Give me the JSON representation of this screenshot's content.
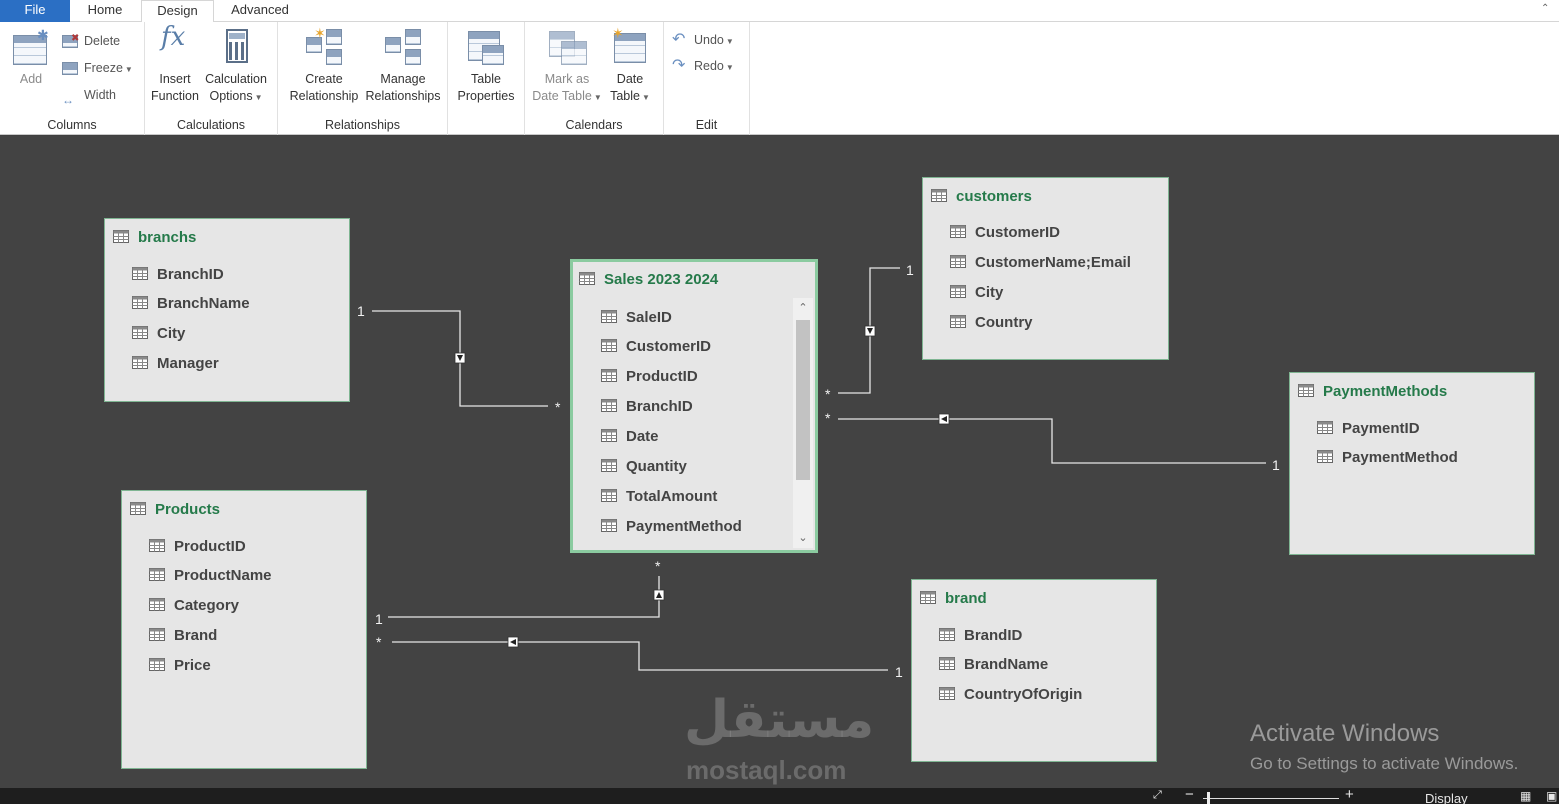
{
  "tabs": {
    "file": "File",
    "home": "Home",
    "design": "Design",
    "advanced": "Advanced"
  },
  "ribbon": {
    "columns": {
      "add": "Add",
      "delete": "Delete",
      "freeze": "Freeze",
      "width": "Width",
      "label": "Columns"
    },
    "calculations": {
      "insert_function_1": "Insert",
      "insert_function_2": "Function",
      "calc_options_1": "Calculation",
      "calc_options_2": "Options",
      "label": "Calculations"
    },
    "relationships": {
      "create_1": "Create",
      "create_2": "Relationship",
      "manage_1": "Manage",
      "manage_2": "Relationships",
      "label": "Relationships"
    },
    "table_properties": {
      "line1": "Table",
      "line2": "Properties"
    },
    "calendars": {
      "mark_1": "Mark as",
      "mark_2": "Date Table",
      "date_1": "Date",
      "date_2": "Table",
      "label": "Calendars"
    },
    "edit": {
      "undo": "Undo",
      "redo": "Redo",
      "label": "Edit"
    },
    "fx_glyph": "fx"
  },
  "tables": {
    "branchs": {
      "title": "branchs",
      "fields": [
        "BranchID",
        "BranchName",
        "City",
        "Manager"
      ]
    },
    "sales": {
      "title": "Sales 2023 2024",
      "fields": [
        "SaleID",
        "CustomerID",
        "ProductID",
        "BranchID",
        "Date",
        "Quantity",
        "TotalAmount",
        "PaymentMethod"
      ]
    },
    "customers": {
      "title": "customers",
      "fields": [
        "CustomerID",
        "CustomerName;Email",
        "City",
        "Country"
      ]
    },
    "payment": {
      "title": "PaymentMethods",
      "fields": [
        "PaymentID",
        "PaymentMethod"
      ]
    },
    "products": {
      "title": "Products",
      "fields": [
        "ProductID",
        "ProductName",
        "Category",
        "Brand",
        "Price"
      ]
    },
    "brand": {
      "title": "brand",
      "fields": [
        "BrandID",
        "BrandName",
        "CountryOfOrigin"
      ]
    }
  },
  "cardinality": {
    "branch_one": "1",
    "branch_many": "*",
    "cust_one": "1",
    "cust_many": "*",
    "pay_many": "*",
    "pay_one": "1",
    "prod_one": "1",
    "prod_many_sales": "*",
    "brand_many": "*",
    "brand_one": "1"
  },
  "watermark": {
    "arabic": "مستقل",
    "latin": "mostaql.com"
  },
  "activation": {
    "title": "Activate Windows",
    "subtitle": "Go to Settings to activate Windows."
  },
  "statusbar": {
    "display": "Display"
  },
  "colors": {
    "table_title": "#257a4a",
    "active_border": "#8bcba0",
    "canvas": "#434343",
    "file_tab": "#2b6fc4"
  }
}
